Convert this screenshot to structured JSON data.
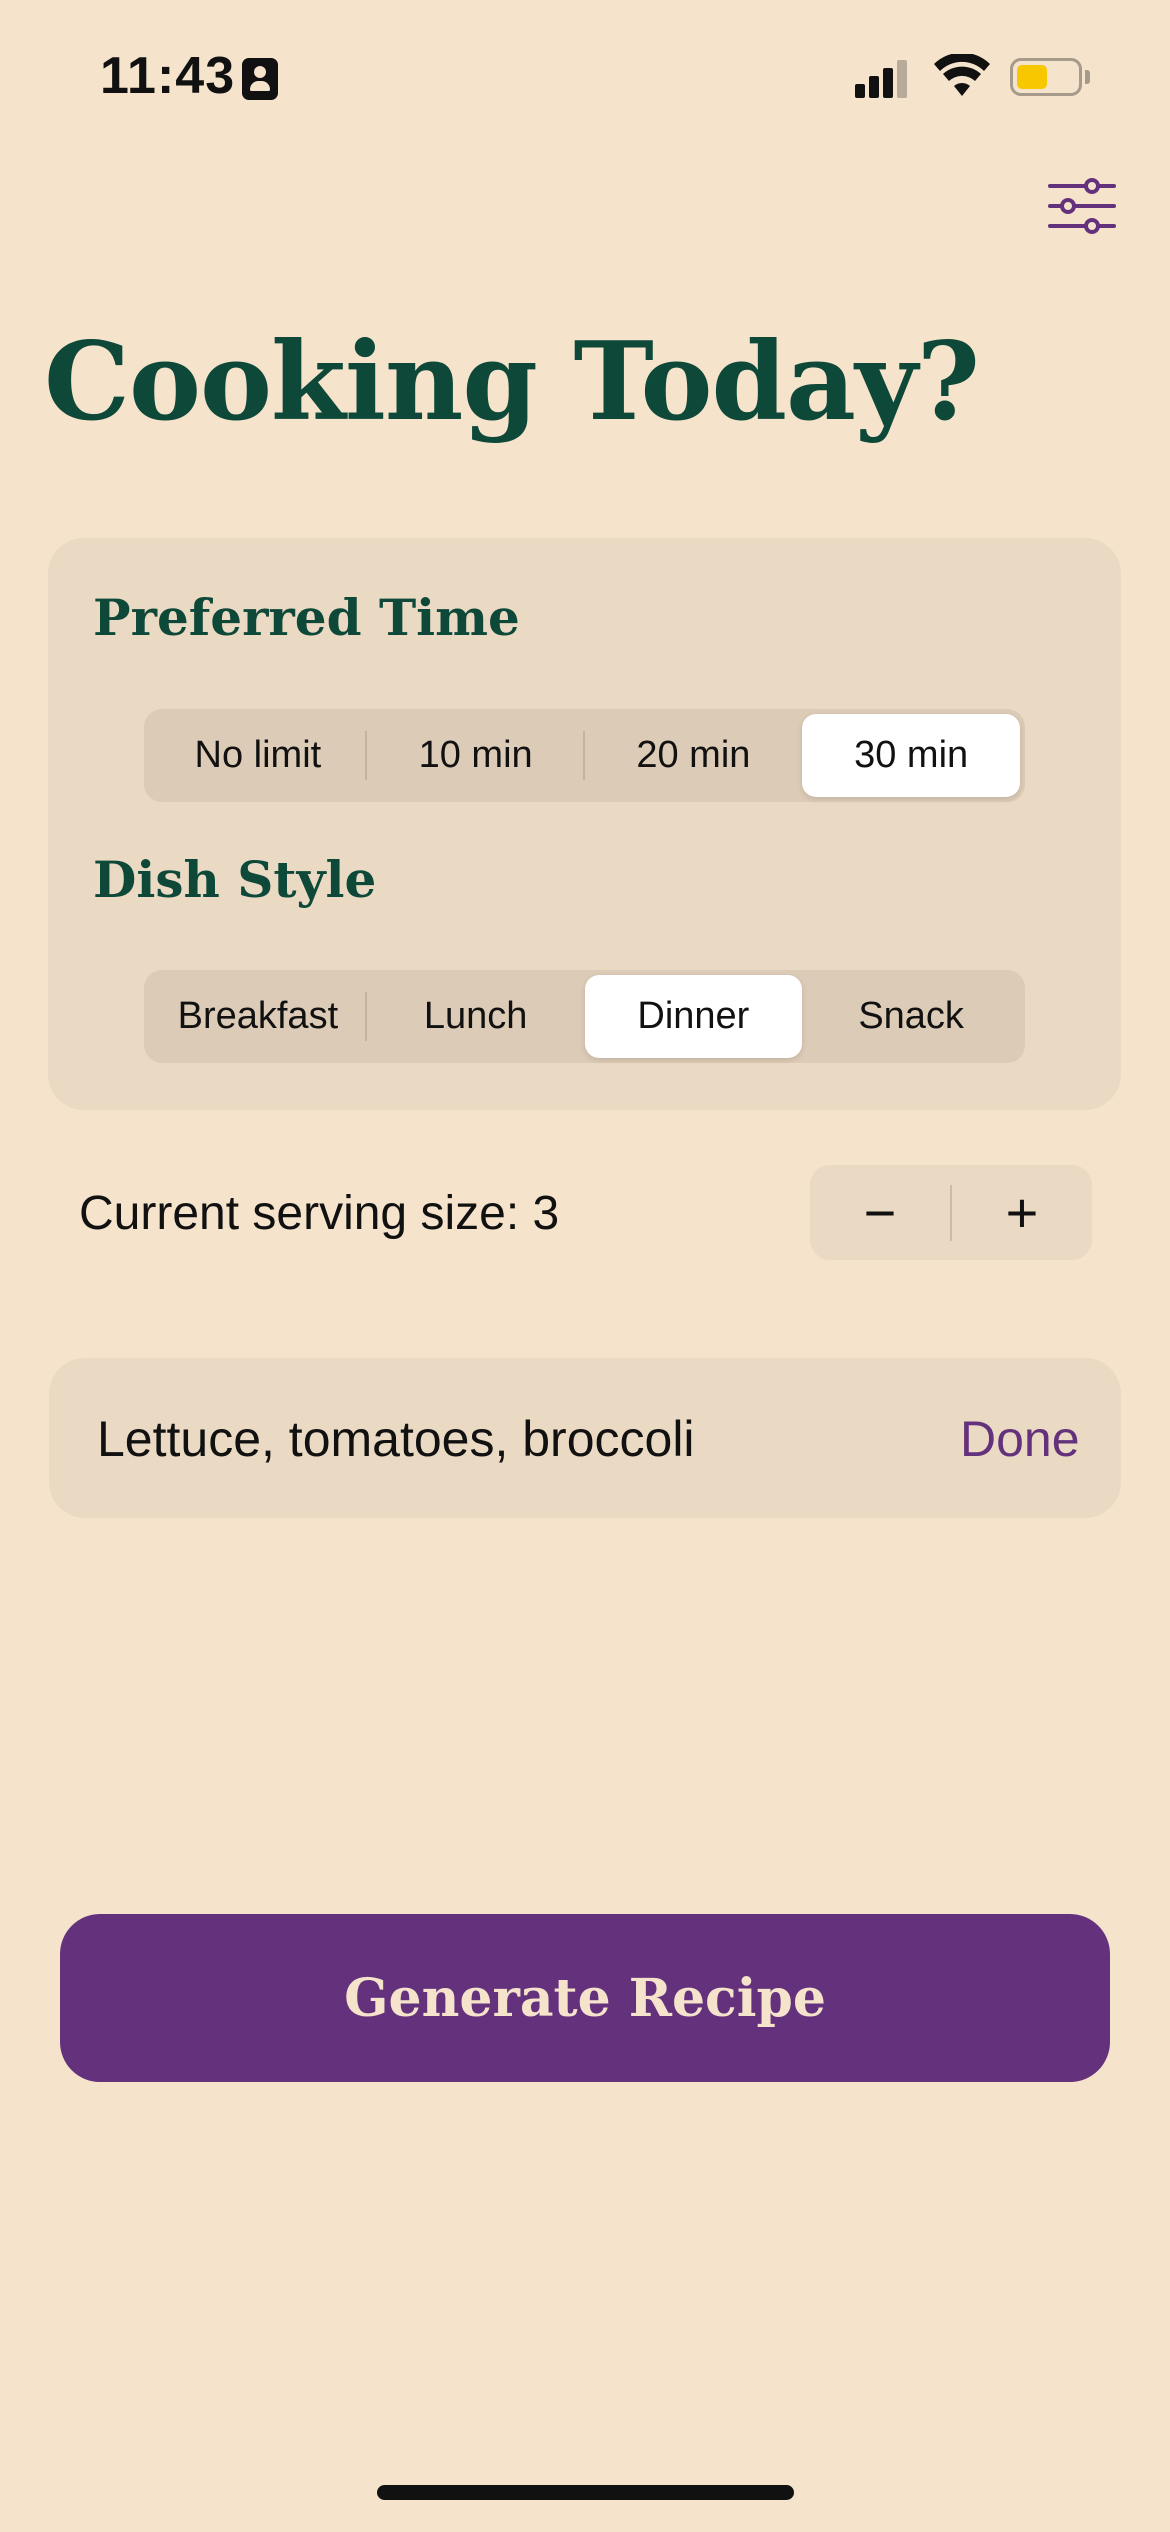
{
  "status_bar": {
    "time": "11:43",
    "battery_level": 0.4,
    "battery_color": "#f7c800"
  },
  "header": {
    "filter_icon": "sliders-icon"
  },
  "title": "Cooking Today?",
  "preferred_time": {
    "heading": "Preferred Time",
    "options": [
      "No limit",
      "10 min",
      "20 min",
      "30 min"
    ],
    "selected": "30 min"
  },
  "dish_style": {
    "heading": "Dish Style",
    "options": [
      "Breakfast",
      "Lunch",
      "Dinner",
      "Snack"
    ],
    "selected": "Dinner"
  },
  "serving": {
    "label": "Current serving size: 3",
    "decrement": "−",
    "increment": "+"
  },
  "ingredients": {
    "value": "Lettuce, tomatoes, broccoli",
    "done_label": "Done"
  },
  "generate": {
    "label": "Generate Recipe"
  },
  "colors": {
    "background": "#f5e3cb",
    "title_green": "#0d4838",
    "accent_purple": "#64327d",
    "card": "#ead9c3"
  }
}
